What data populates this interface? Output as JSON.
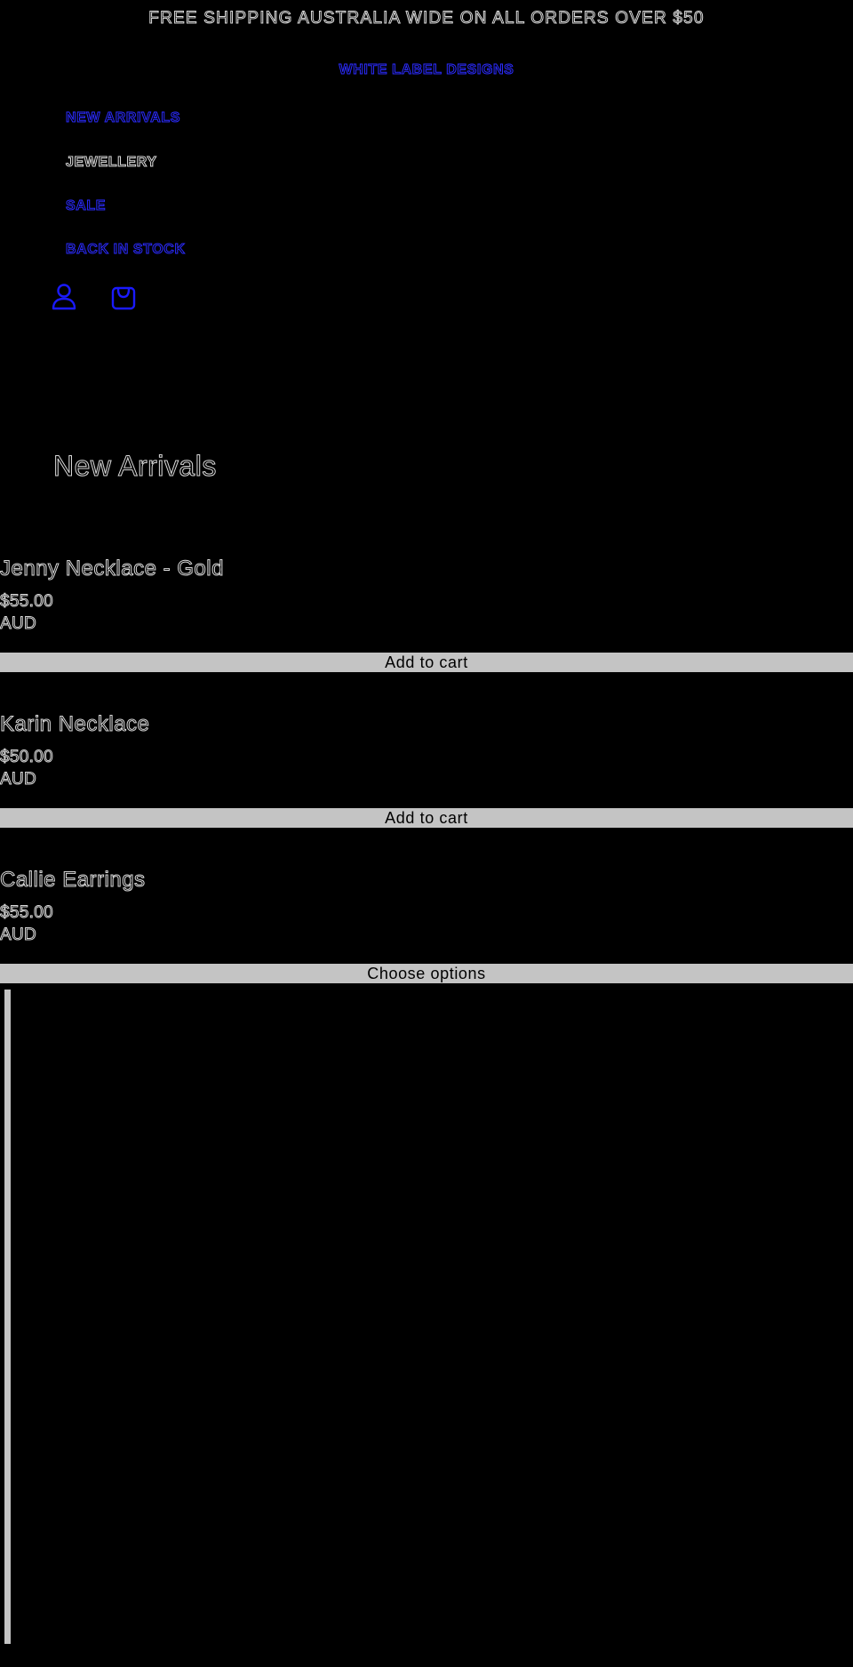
{
  "announcement": "FREE SHIPPING AUSTRALIA WIDE ON ALL ORDERS OVER $50",
  "brand": "WHITE LABEL DESIGNS",
  "nav": {
    "items": [
      {
        "label": "NEW ARRIVALS"
      },
      {
        "label": "JEWELLERY"
      },
      {
        "label": "SALE"
      },
      {
        "label": "BACK IN STOCK"
      }
    ]
  },
  "icons": {
    "account": "account-icon",
    "cart": "cart-icon"
  },
  "collection": {
    "title": "New Arrivals"
  },
  "products": [
    {
      "title": "Jenny Necklace - Gold",
      "price": "$55.00",
      "currency": "AUD",
      "button": "Add to cart"
    },
    {
      "title": "Karin Necklace",
      "price": "$50.00",
      "currency": "AUD",
      "button": "Add to cart"
    },
    {
      "title": "Callie Earrings",
      "price": "$55.00",
      "currency": "AUD",
      "button": "Choose options"
    }
  ],
  "colors": {
    "background": "#000000",
    "text_outline": "#d9d9d9",
    "link": "#2b2bff",
    "button": "#c4c4c4"
  }
}
